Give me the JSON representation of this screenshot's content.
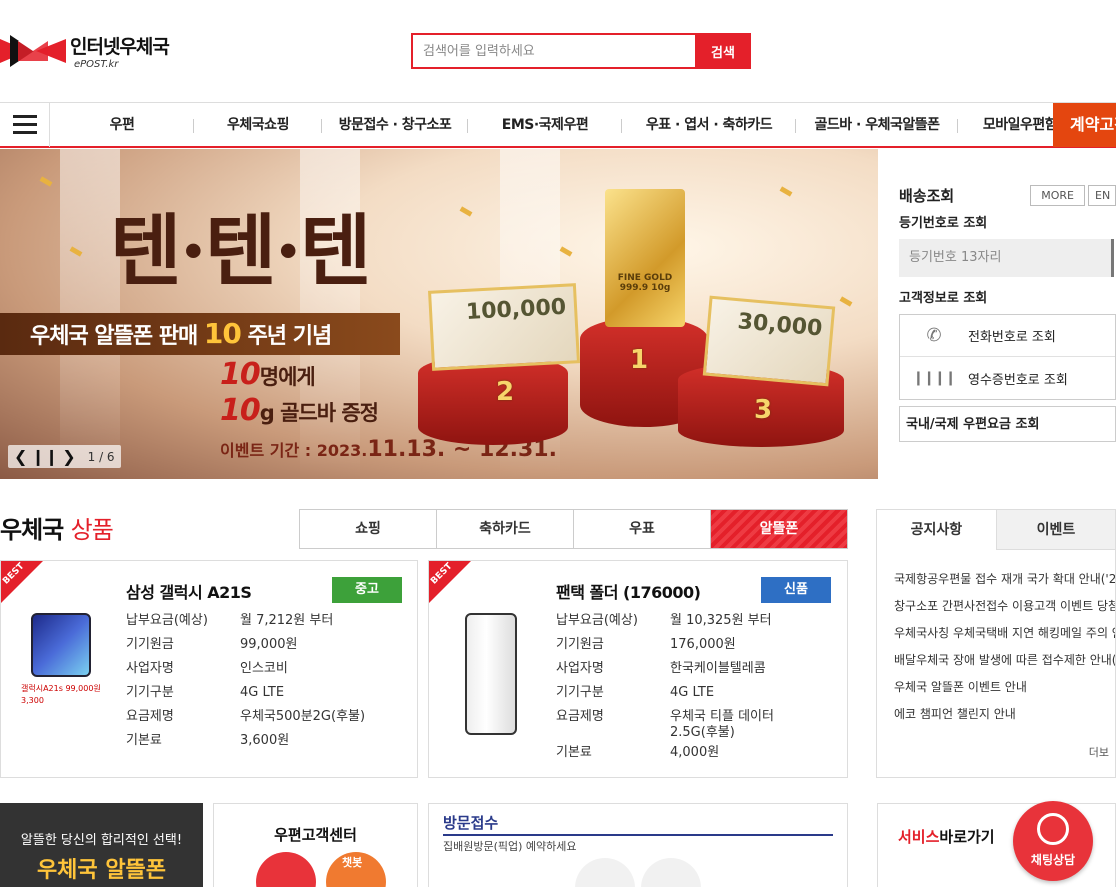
{
  "brand": {
    "name": "인터넷우체국",
    "sub": "ePOST.kr",
    "colors": {
      "primary": "#e4202a",
      "accent": "#e4460f"
    }
  },
  "search": {
    "placeholder": "검색어를 입력하세요",
    "button": "검색"
  },
  "nav": {
    "items": [
      "우편",
      "우체국쇼핑",
      "방문접수 · 창구소포",
      "EMS·국제우편",
      "우표 · 엽서 · 축하카드",
      "골드바 · 우체국알뜰폰",
      "모바일우편함"
    ],
    "contract": "계약고객"
  },
  "banner": {
    "title": "텐·텐·텐",
    "ribbon_pre": "우체국 알뜰폰 판매",
    "ribbon_num": "10",
    "ribbon_post": "주년 기념",
    "line1_num": "10",
    "line1_text": "명에게",
    "line2_num": "10",
    "line2_text": "g 골드바 증정",
    "period_label": "이벤트 기간 : 2023.",
    "period_value": "11.13. ~ 12.31.",
    "voucher1": "100,000",
    "voucher2": "30,000",
    "gold": "FINE GOLD 999.9 10g",
    "places": [
      "2",
      "1",
      "3"
    ],
    "slide": "1 / 6"
  },
  "tracking": {
    "title": "배송조회",
    "more": "MORE",
    "en": "EN",
    "by_number": "등기번호로 조회",
    "input_placeholder": "등기번호 13자리",
    "by_customer": "고객정보로 조회",
    "phone": "전화번호로 조회",
    "receipt": "영수증번호로 조회",
    "rate": "국내/국제 우편요금 조회"
  },
  "products": {
    "title": "우체국",
    "title_accent": "상품",
    "tabs": [
      "쇼핑",
      "축하카드",
      "우표",
      "알뜰폰"
    ],
    "active_tab": "알뜰폰",
    "best": "BEST",
    "cards": [
      {
        "name": "삼성 갤럭시 A21S",
        "badge": "중고",
        "badge_color": "#3da13a",
        "img_caption": "갤럭시A21s 99,000원 3,300",
        "specs": [
          [
            "납부요금(예상)",
            "월 7,212원 부터"
          ],
          [
            "기기원금",
            "99,000원"
          ],
          [
            "사업자명",
            "인스코비"
          ],
          [
            "기기구분",
            "4G LTE"
          ],
          [
            "요금제명",
            "우체국500분2G(후불)"
          ],
          [
            "기본료",
            "3,600원"
          ]
        ]
      },
      {
        "name": "팬택 폴더 (176000)",
        "badge": "신품",
        "badge_color": "#2e6fc4",
        "specs": [
          [
            "납부요금(예상)",
            "월 10,325원 부터"
          ],
          [
            "기기원금",
            "176,000원"
          ],
          [
            "사업자명",
            "한국케이블텔레콤"
          ],
          [
            "기기구분",
            "4G LTE"
          ],
          [
            "요금제명",
            "우체국 티플 데이터2.5G(후불)"
          ],
          [
            "기본료",
            "4,000원"
          ]
        ]
      }
    ]
  },
  "notice": {
    "tabs": [
      "공지사항",
      "이벤트"
    ],
    "items": [
      "국제항공우편물 접수 재개 국가 확대 안내('23",
      "창구소포 간편사전접수 이용고객 이벤트 당첨..",
      "우체국사칭 우체국택배 지연 해킹메일 주의 안..",
      "배달우체국 장애 발생에 따른 접수제한 안내(..",
      "우체국 알뜰폰 이벤트 안내",
      "에코 챔피언 챌린지 안내"
    ],
    "more": "더보"
  },
  "bottom": {
    "alddle_sub": "알뜰한 당신의 합리적인 선택!",
    "alddle_main": "우체국 알뜰폰",
    "center": "우편고객센터",
    "chatbot": "챗봇",
    "visit_title": "방문접수",
    "visit_sub": "집배원방문(픽업) 예약하세요",
    "service_pre": "서비스",
    "service_post": "바로가기",
    "chat": "채팅상담"
  }
}
